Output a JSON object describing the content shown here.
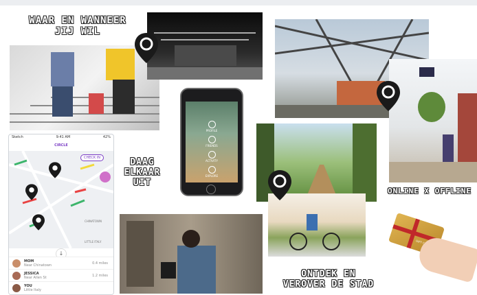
{
  "captions": {
    "where": [
      "WAAR EN WANNEER",
      "JIJ WIL"
    ],
    "daag": [
      "DAAG",
      "ELKAAR",
      "UIT"
    ],
    "online": "ONLINE X OFFLINE",
    "ontdek": [
      "ONTDEK EN",
      "VEROVER DE STAD"
    ]
  },
  "map_app": {
    "status_left": "Sketch",
    "status_time": "9:41 AM",
    "status_right": "42%",
    "tab_active": "CIRCLE",
    "checkin": "CHECK IN",
    "labels": [
      "LITTLE ITALY",
      "CHINATOWN"
    ],
    "people": [
      {
        "name": "MOM",
        "sub": "Near Chinatown",
        "dist": "0.4 miles"
      },
      {
        "name": "JESSICA",
        "sub": "Near Allen St",
        "dist": "1.2 miles"
      },
      {
        "name": "YOU",
        "sub": "Little Italy",
        "dist": ""
      }
    ]
  },
  "phone_menu": {
    "items": [
      "PROFILE",
      "FRIENDS",
      "ACTIVITY",
      "EXPLORE"
    ]
  },
  "gift_card": "GIFT CARD",
  "colors": {
    "pin": "#1a1a1a",
    "accent": "#7a3cc5",
    "gold": "#d4a23a"
  }
}
